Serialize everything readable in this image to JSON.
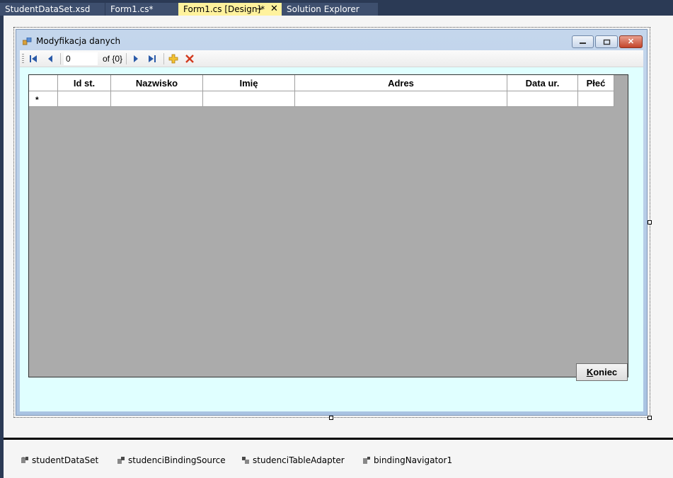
{
  "tabs": [
    {
      "label": "StudentDataSet.xsd",
      "state": "inactive"
    },
    {
      "label": "Form1.cs*",
      "state": "inactive"
    },
    {
      "label": "Form1.cs [Design]*",
      "state": "active"
    },
    {
      "label": "Solution Explorer",
      "state": "inactive"
    }
  ],
  "form": {
    "title": "Modyfikacja danych",
    "caption_buttons": {
      "minimize": "minimize-icon",
      "maximize": "maximize-icon",
      "close": "close-icon"
    }
  },
  "navigator": {
    "position": "0",
    "count_label": "of {0}",
    "buttons": [
      "move-first-icon",
      "move-previous-icon",
      "move-next-icon",
      "move-last-icon",
      "add-new-icon",
      "delete-icon"
    ]
  },
  "grid": {
    "columns": [
      "Id st.",
      "Nazwisko",
      "Imię",
      "Adres",
      "Data ur.",
      "Płeć"
    ],
    "new_row_marker": "*"
  },
  "koniec_button": {
    "accel": "K",
    "rest": "oniec"
  },
  "tray": [
    "studentDataSet",
    "studenciBindingSource",
    "studenciTableAdapter",
    "bindingNavigator1"
  ],
  "colors": {
    "tab_strip": "#2b3a55",
    "active_tab": "#fff29d",
    "form_client": "#e0ffff",
    "grid_background": "#ababab"
  }
}
